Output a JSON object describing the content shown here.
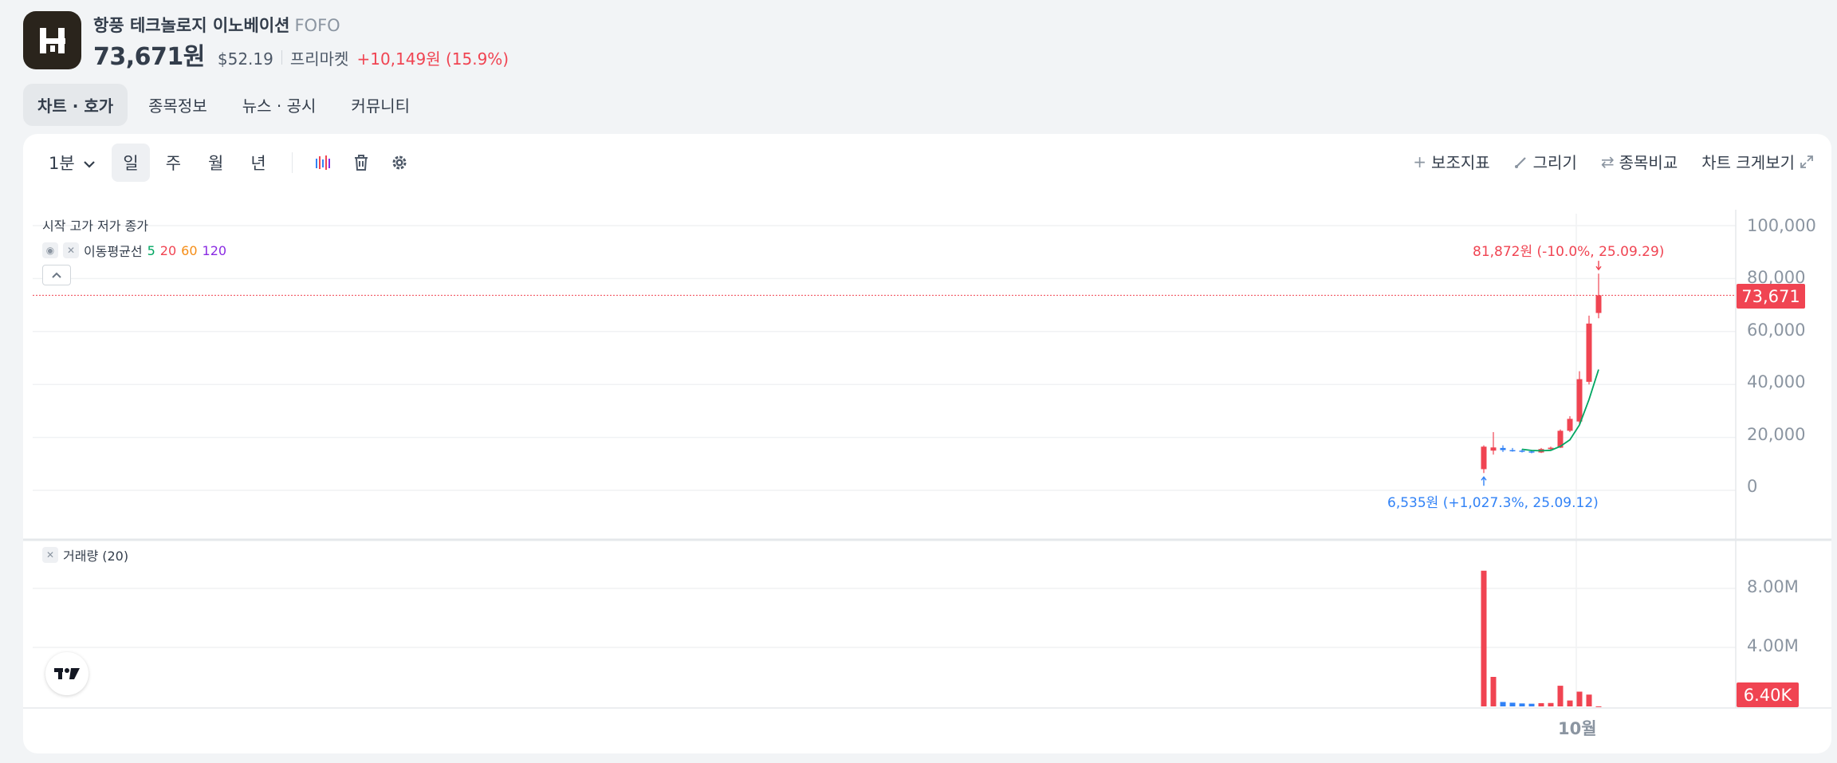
{
  "stock": {
    "name": "항풍 테크놀로지 이노베이션",
    "ticker": "FOFO",
    "price": "73,671원",
    "price_usd": "$52.19",
    "session_label": "프리마켓",
    "change": "+10,149원 (15.9%)",
    "logo_icon": "stock-logo-icon"
  },
  "tabs": [
    "차트 · 호가",
    "종목정보",
    "뉴스 · 공시",
    "커뮤니티"
  ],
  "toolbar": {
    "interval": "1분",
    "periods": [
      "일",
      "주",
      "월",
      "년"
    ],
    "icons": [
      "candle-type-icon",
      "trash-icon",
      "gear-icon"
    ],
    "indicators": "보조지표",
    "draw": "그리기",
    "compare": "종목비교",
    "expand": "차트 크게보기"
  },
  "chart": {
    "ohlc_legend": "시작 고가 저가 종가",
    "ma_label": "이동평균선",
    "ma_periods": [
      "5",
      "20",
      "60",
      "120"
    ],
    "ma_colors": [
      "#00a661",
      "#f04452",
      "#f58d16",
      "#8a2be2"
    ],
    "volume_label": "거래량 (20)",
    "current_price_tag": "73,671",
    "volume_tag": "6.40K",
    "high_annotation": "81,872원 (-10.0%, 25.09.29)",
    "low_annotation": "6,535원 (+1,027.3%, 25.09.12)",
    "price_ticks": [
      "100,000",
      "80,000",
      "60,000",
      "40,000",
      "20,000",
      "0"
    ],
    "volume_ticks": [
      "8.00M",
      "4.00M"
    ],
    "x_label": "10월",
    "up_color": "#f04452",
    "down_color": "#3182f6"
  },
  "chart_data": {
    "type": "candlestick",
    "ylim": [
      0,
      100000
    ],
    "volume_ylim": [
      0,
      10000000
    ],
    "candles": [
      {
        "o": 8000,
        "h": 17000,
        "l": 6535,
        "c": 16500,
        "v": 9200000
      },
      {
        "o": 15000,
        "h": 22000,
        "l": 13500,
        "c": 16200,
        "v": 2000000
      },
      {
        "o": 16000,
        "h": 17000,
        "l": 14500,
        "c": 15200,
        "v": 300000
      },
      {
        "o": 15200,
        "h": 16000,
        "l": 14600,
        "c": 15000,
        "v": 250000
      },
      {
        "o": 15000,
        "h": 15600,
        "l": 14300,
        "c": 14600,
        "v": 200000
      },
      {
        "o": 14700,
        "h": 15200,
        "l": 14000,
        "c": 14300,
        "v": 180000
      },
      {
        "o": 14300,
        "h": 16000,
        "l": 14100,
        "c": 15600,
        "v": 220000
      },
      {
        "o": 15600,
        "h": 16500,
        "l": 15000,
        "c": 16100,
        "v": 230000
      },
      {
        "o": 16100,
        "h": 23000,
        "l": 16000,
        "c": 22500,
        "v": 1400000
      },
      {
        "o": 22500,
        "h": 28000,
        "l": 22000,
        "c": 27000,
        "v": 400000
      },
      {
        "o": 26000,
        "h": 45000,
        "l": 25000,
        "c": 42000,
        "v": 1000000
      },
      {
        "o": 41000,
        "h": 66000,
        "l": 40000,
        "c": 63000,
        "v": 800000
      },
      {
        "o": 67000,
        "h": 81872,
        "l": 65000,
        "c": 73671,
        "v": 6400
      }
    ],
    "ma5": [
      null,
      null,
      null,
      null,
      15500,
      15060,
      14940,
      15120,
      16620,
      19100,
      24700,
      34320,
      45634
    ]
  }
}
